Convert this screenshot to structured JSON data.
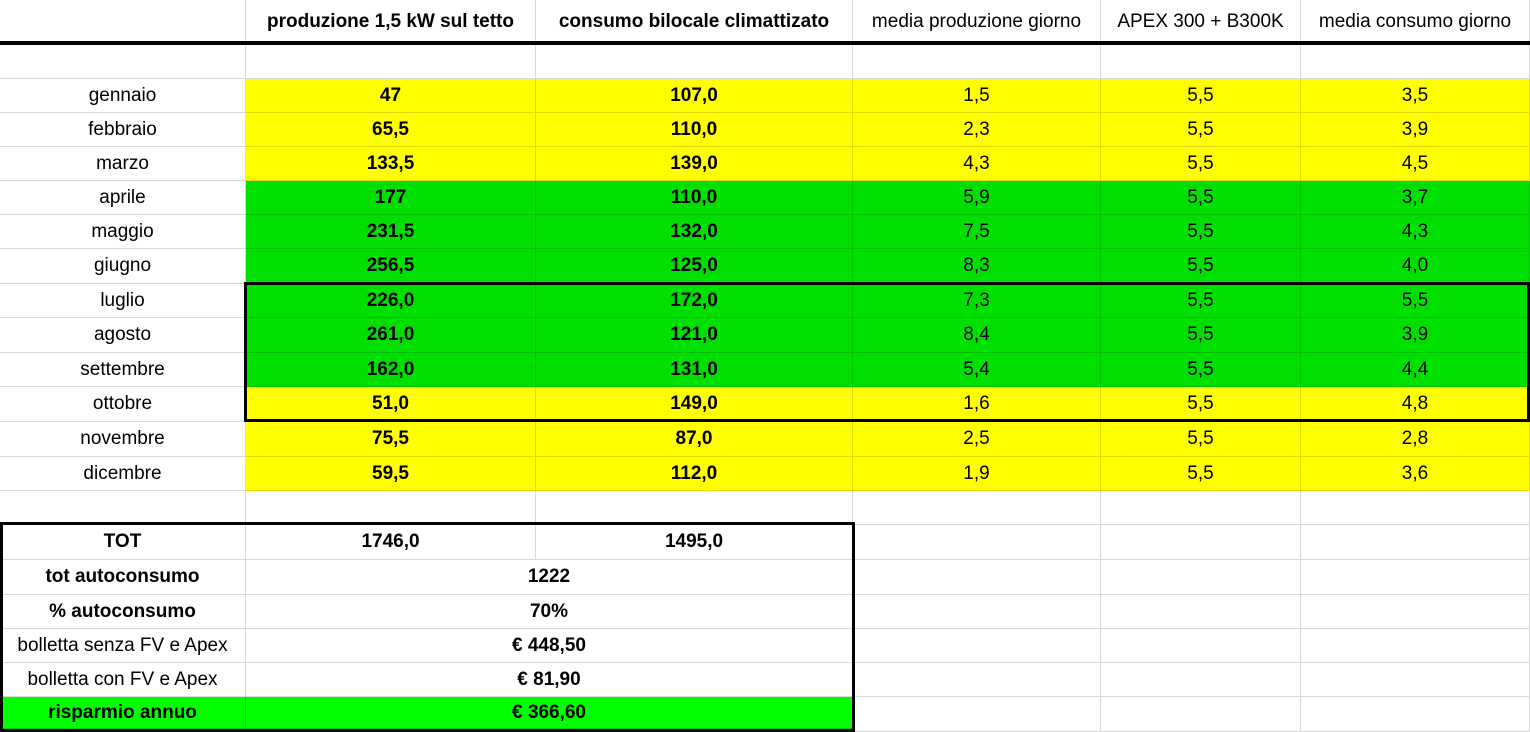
{
  "headers": [
    "",
    "produzione 1,5 kW sul tetto",
    "consumo bilocale climattizato",
    "media produzione giorno",
    "APEX 300 + B300K",
    "media consumo giorno"
  ],
  "months": [
    {
      "name": "gennaio",
      "prod": "47",
      "cons": "107,0",
      "media_prod": "1,5",
      "apex": "5,5",
      "media_cons": "3,5",
      "color": "yellow"
    },
    {
      "name": "febbraio",
      "prod": "65,5",
      "cons": "110,0",
      "media_prod": "2,3",
      "apex": "5,5",
      "media_cons": "3,9",
      "color": "yellow"
    },
    {
      "name": "marzo",
      "prod": "133,5",
      "cons": "139,0",
      "media_prod": "4,3",
      "apex": "5,5",
      "media_cons": "4,5",
      "color": "yellow"
    },
    {
      "name": "aprile",
      "prod": "177",
      "cons": "110,0",
      "media_prod": "5,9",
      "apex": "5,5",
      "media_cons": "3,7",
      "color": "green"
    },
    {
      "name": "maggio",
      "prod": "231,5",
      "cons": "132,0",
      "media_prod": "7,5",
      "apex": "5,5",
      "media_cons": "4,3",
      "color": "green"
    },
    {
      "name": "giugno",
      "prod": "256,5",
      "cons": "125,0",
      "media_prod": "8,3",
      "apex": "5,5",
      "media_cons": "4,0",
      "color": "green"
    },
    {
      "name": "luglio",
      "prod": "226,0",
      "cons": "172,0",
      "media_prod": "7,3",
      "apex": "5,5",
      "media_cons": "5,5",
      "color": "green"
    },
    {
      "name": "agosto",
      "prod": "261,0",
      "cons": "121,0",
      "media_prod": "8,4",
      "apex": "5,5",
      "media_cons": "3,9",
      "color": "green"
    },
    {
      "name": "settembre",
      "prod": "162,0",
      "cons": "131,0",
      "media_prod": "5,4",
      "apex": "5,5",
      "media_cons": "4,4",
      "color": "green"
    },
    {
      "name": "ottobre",
      "prod": "51,0",
      "cons": "149,0",
      "media_prod": "1,6",
      "apex": "5,5",
      "media_cons": "4,8",
      "color": "yellow"
    },
    {
      "name": "novembre",
      "prod": "75,5",
      "cons": "87,0",
      "media_prod": "2,5",
      "apex": "5,5",
      "media_cons": "2,8",
      "color": "yellow"
    },
    {
      "name": "dicembre",
      "prod": "59,5",
      "cons": "112,0",
      "media_prod": "1,9",
      "apex": "5,5",
      "media_cons": "3,6",
      "color": "yellow"
    }
  ],
  "summary": {
    "tot_label": "TOT",
    "tot_prod": "1746,0",
    "tot_cons": "1495,0",
    "autoconsumo_label": "tot autoconsumo",
    "autoconsumo_value": "1222",
    "perc_label": "% autoconsumo",
    "perc_value": "70%",
    "senza_label": "bolletta senza FV e Apex",
    "senza_value": "€ 448,50",
    "con_label": "bolletta con FV e Apex",
    "con_value": "€ 81,90",
    "risparmio_label": "risparmio annuo",
    "risparmio_value": "€ 366,60"
  },
  "colors": {
    "yellow": "#ffff00",
    "green": "#00e000",
    "lime": "#00ff00",
    "grid": "#d9d9d9"
  }
}
